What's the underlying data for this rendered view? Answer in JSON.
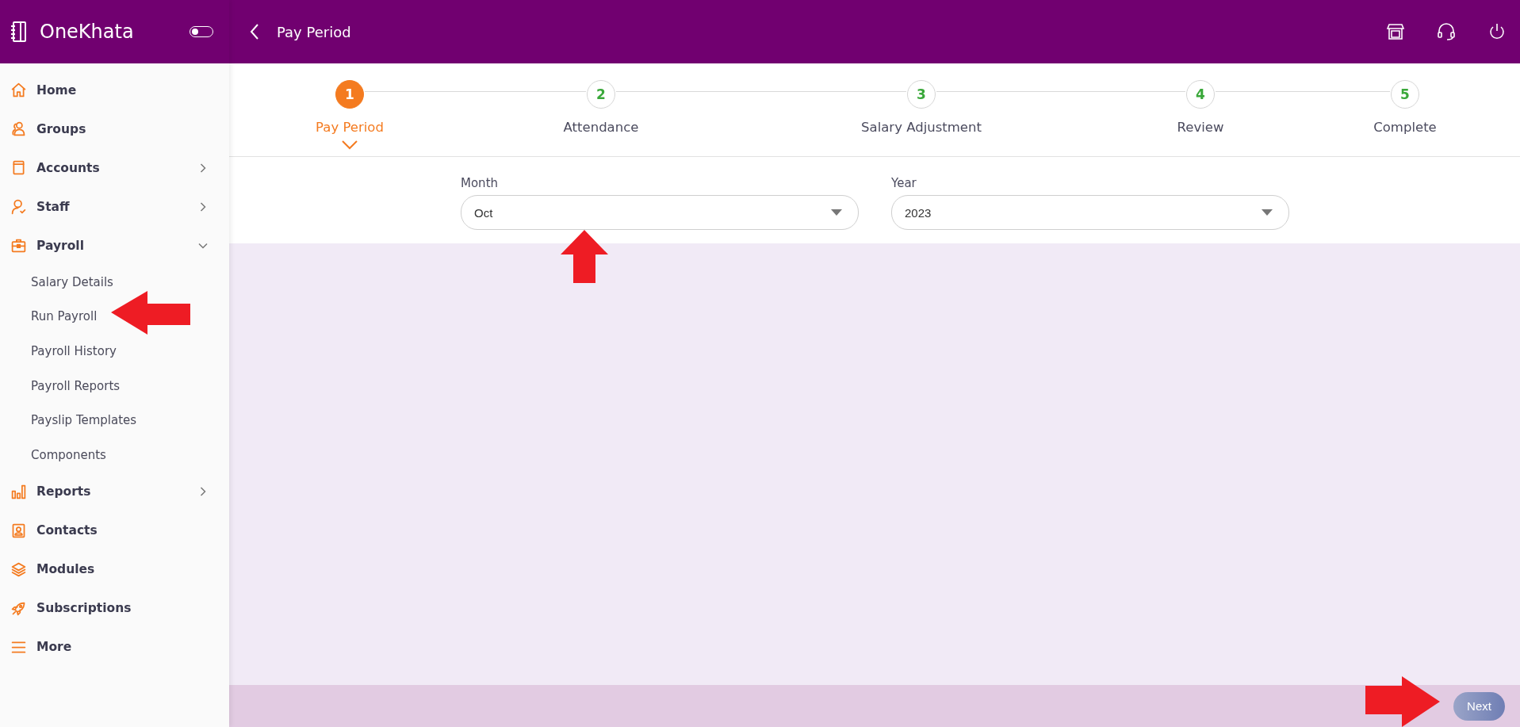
{
  "app": {
    "name": "OneKhata",
    "theme_toggle": {
      "on": false
    }
  },
  "header": {
    "title": "Pay Period"
  },
  "sidebar": {
    "items": [
      {
        "label": "Home",
        "kind": "link"
      },
      {
        "label": "Groups",
        "kind": "link"
      },
      {
        "label": "Accounts",
        "kind": "menu",
        "expanded": false
      },
      {
        "label": "Staff",
        "kind": "menu",
        "expanded": false
      },
      {
        "label": "Payroll",
        "kind": "menu",
        "expanded": true,
        "children": [
          {
            "label": "Salary Details"
          },
          {
            "label": "Run Payroll"
          },
          {
            "label": "Payroll History"
          },
          {
            "label": "Payroll Reports"
          },
          {
            "label": "Payslip Templates"
          },
          {
            "label": "Components"
          }
        ]
      },
      {
        "label": "Reports",
        "kind": "menu",
        "expanded": false
      },
      {
        "label": "Contacts",
        "kind": "link"
      },
      {
        "label": "Modules",
        "kind": "link"
      },
      {
        "label": "Subscriptions",
        "kind": "link"
      },
      {
        "label": "More",
        "kind": "link"
      }
    ]
  },
  "stepper": {
    "steps": [
      {
        "number": "1",
        "label": "Pay Period",
        "selected": true
      },
      {
        "number": "2",
        "label": "Attendance",
        "selected": false
      },
      {
        "number": "3",
        "label": "Salary Adjustment",
        "selected": false
      },
      {
        "number": "4",
        "label": "Review",
        "selected": false
      },
      {
        "number": "5",
        "label": "Complete",
        "selected": false
      }
    ]
  },
  "form": {
    "fields": [
      {
        "label": "Month",
        "value": "Oct"
      },
      {
        "label": "Year",
        "value": "2023"
      }
    ]
  },
  "footer": {
    "next_button": {
      "label": "Next",
      "disabled": true
    }
  }
}
